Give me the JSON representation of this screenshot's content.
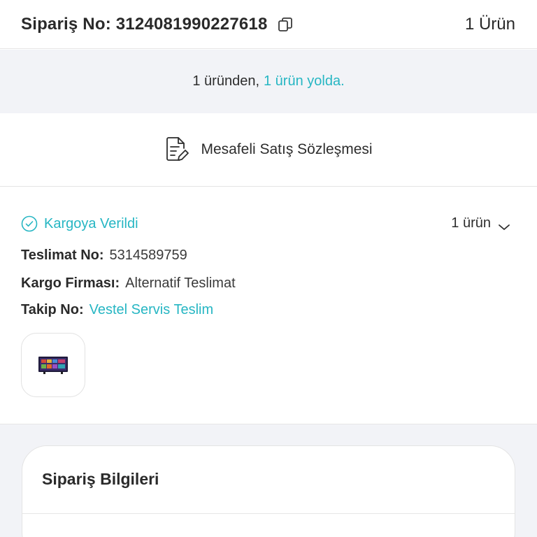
{
  "header": {
    "order_no": "Sipariş No: 3124081990227618",
    "item_count": "1 Ürün"
  },
  "status_banner": {
    "prefix": "1 üründen,",
    "highlight": "1 ürün yolda."
  },
  "contract": {
    "label": "Mesafeli Satış Sözleşmesi"
  },
  "shipment": {
    "status": "Kargoya Verildi",
    "item_count": "1 ürün",
    "delivery_no_label": "Teslimat No:",
    "delivery_no": "5314589759",
    "carrier_label": "Kargo Firması:",
    "carrier": "Alternatif Teslimat",
    "tracking_label": "Takip No:",
    "tracking": "Vestel Servis Teslim"
  },
  "order_info": {
    "title": "Sipariş Bilgileri"
  },
  "colors": {
    "accent": "#26b6c3",
    "background_gray": "#f2f3f7"
  },
  "icons": [
    "copy-icon",
    "document-edit-icon",
    "check-circle-icon",
    "chevron-down-icon"
  ]
}
